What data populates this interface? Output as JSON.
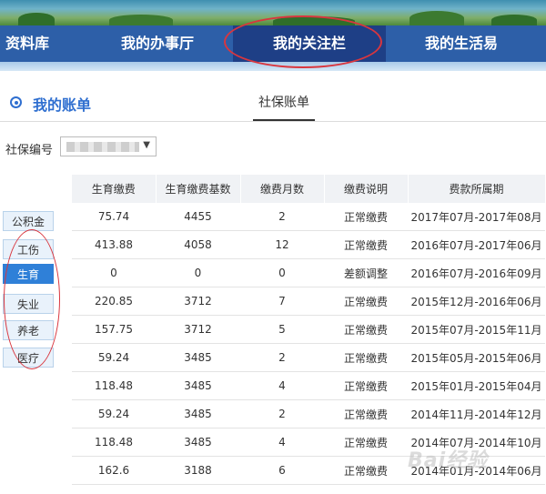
{
  "nav": {
    "items": [
      "资料库",
      "我的办事厅",
      "我的关注栏",
      "我的生活易"
    ],
    "active_index": 2
  },
  "account": {
    "title": "我的账单",
    "tab": "社保账单"
  },
  "filter": {
    "label": "社保编号",
    "arrow": "▼"
  },
  "side_tabs": [
    "公积金",
    "工伤",
    "生育",
    "失业",
    "养老",
    "医疗"
  ],
  "side_active": "生育",
  "table": {
    "headers": [
      "生育缴费",
      "生育缴费基数",
      "缴费月数",
      "缴费说明",
      "费款所属期"
    ],
    "rows": [
      [
        "75.74",
        "4455",
        "2",
        "正常缴费",
        "2017年07月-2017年08月"
      ],
      [
        "413.88",
        "4058",
        "12",
        "正常缴费",
        "2016年07月-2017年06月"
      ],
      [
        "0",
        "0",
        "0",
        "差额调整",
        "2016年07月-2016年09月"
      ],
      [
        "220.85",
        "3712",
        "7",
        "正常缴费",
        "2015年12月-2016年06月"
      ],
      [
        "157.75",
        "3712",
        "5",
        "正常缴费",
        "2015年07月-2015年11月"
      ],
      [
        "59.24",
        "3485",
        "2",
        "正常缴费",
        "2015年05月-2015年06月"
      ],
      [
        "118.48",
        "3485",
        "4",
        "正常缴费",
        "2015年01月-2015年04月"
      ],
      [
        "59.24",
        "3485",
        "2",
        "正常缴费",
        "2014年11月-2014年12月"
      ],
      [
        "118.48",
        "3485",
        "4",
        "正常缴费",
        "2014年07月-2014年10月"
      ],
      [
        "162.6",
        "3188",
        "6",
        "正常缴费",
        "2014年01月-2014年06月"
      ]
    ]
  },
  "watermark": "Bai经验",
  "colors": {
    "nav_bg": "#2d5fa8",
    "nav_active": "#1e3f86",
    "accent": "#2f6fd0",
    "annotation": "#d9363e"
  }
}
